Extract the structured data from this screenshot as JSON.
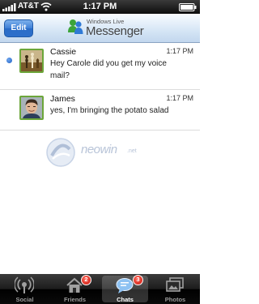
{
  "status_bar": {
    "carrier": "AT&T",
    "time": "1:17 PM"
  },
  "nav": {
    "edit_label": "Edit",
    "logo_small": "Windows Live",
    "logo_main": "Messenger"
  },
  "chats": [
    {
      "name": "Cassie",
      "time": "1:17 PM",
      "message": "Hey Carole did you get my voice mail?",
      "unread": true
    },
    {
      "name": "James",
      "time": "1:17 PM",
      "message": "yes, I'm bringing the potato salad",
      "unread": false
    }
  ],
  "watermark": {
    "text": "neowin",
    "suffix": ".net"
  },
  "tabs": [
    {
      "label": "Social",
      "icon": "social-icon"
    },
    {
      "label": "Friends",
      "icon": "friends-icon",
      "badge": "2"
    },
    {
      "label": "Chats",
      "icon": "chats-icon",
      "badge": "3",
      "selected": true
    },
    {
      "label": "Photos",
      "icon": "photos-icon"
    }
  ],
  "colors": {
    "accent_blue": "#2d6fca",
    "avatar_border": "#6ca63a",
    "badge_red": "#c8140a"
  }
}
